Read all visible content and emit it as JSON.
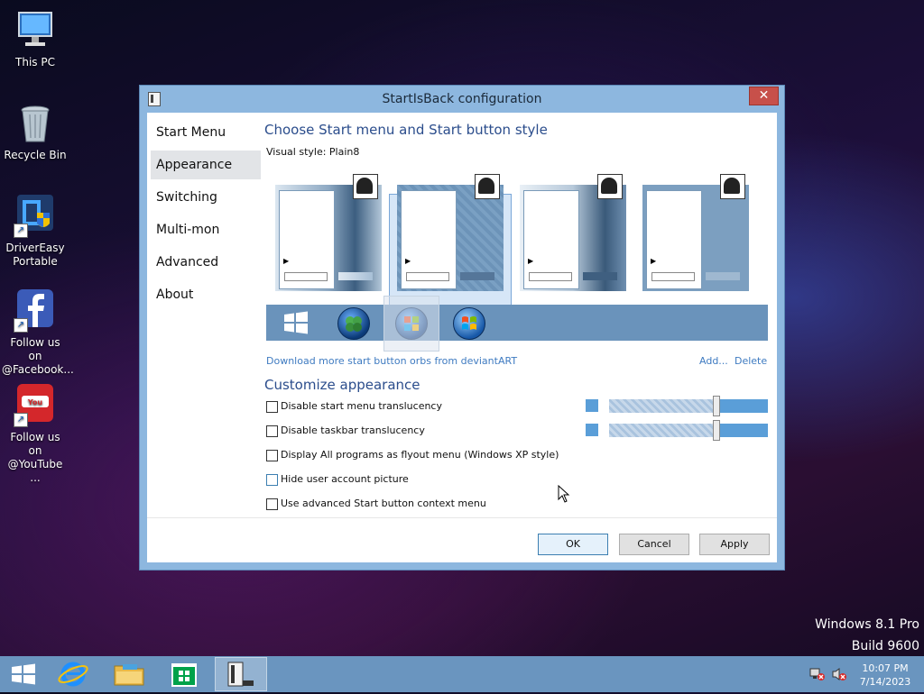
{
  "desktop": {
    "icons": [
      {
        "label": "This PC"
      },
      {
        "label": "Recycle Bin"
      },
      {
        "label": "DriverEasy Portable"
      },
      {
        "label": "Follow us on @Facebook..."
      },
      {
        "label": "Follow us on @YouTube ..."
      }
    ],
    "watermark": {
      "line1": "Windows 8.1 Pro",
      "line2": "Build 9600"
    }
  },
  "window": {
    "title": "StartIsBack configuration",
    "close_glyph": "✕",
    "nav": [
      {
        "label": "Start Menu"
      },
      {
        "label": "Appearance",
        "selected": true
      },
      {
        "label": "Switching"
      },
      {
        "label": "Multi-mon"
      },
      {
        "label": "Advanced"
      },
      {
        "label": "About"
      }
    ],
    "style_section": {
      "title": "Choose Start menu and Start button style",
      "visual_style_label": "Visual style:",
      "visual_style_value": "Plain8",
      "selected_tile": 2,
      "orbs": [
        "windows-flag-white",
        "clover-orb",
        "windows-color-orb",
        "windows7-orb"
      ],
      "selected_orb": 3,
      "download_link": "Download more start button orbs from deviantART",
      "add_link": "Add...",
      "delete_link": "Delete"
    },
    "customize_section": {
      "title": "Customize appearance",
      "options": [
        {
          "label": "Disable start menu translucency",
          "checked": false
        },
        {
          "label": "Disable taskbar translucency",
          "checked": false
        },
        {
          "label": "Display All programs as flyout menu (Windows XP style)",
          "checked": false
        },
        {
          "label": "Hide user account picture",
          "checked": false
        },
        {
          "label": "Use advanced Start button context menu",
          "checked": false
        }
      ],
      "start_menu_translucency": 0.67,
      "taskbar_translucency": 0.67,
      "accent_color": "#5a9ed8"
    },
    "buttons": {
      "ok": "OK",
      "cancel": "Cancel",
      "apply": "Apply"
    }
  },
  "taskbar": {
    "time": "10:07 PM",
    "date": "7/14/2023",
    "color": "#6a95bf",
    "pinned": [
      "start-button",
      "internet-explorer-icon",
      "file-explorer-icon",
      "store-icon",
      "startisback-icon"
    ]
  }
}
